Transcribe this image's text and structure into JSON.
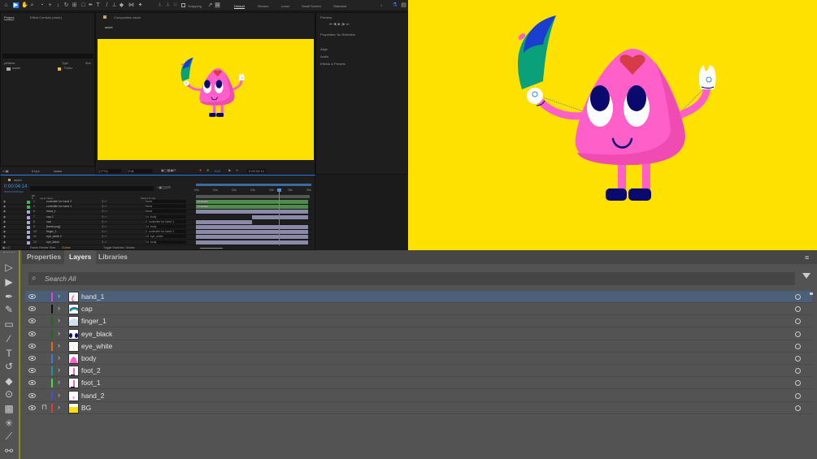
{
  "ae": {
    "toolbar": {
      "snapping": "Snapping",
      "workspaces": [
        "Default",
        "Review",
        "Learn",
        "Small Screen",
        "Standard"
      ],
      "more": "»"
    },
    "project": {
      "tabs": [
        "Project",
        "Effect Controls (none)"
      ],
      "search_placeholder": "ρ▾",
      "columns": [
        "Name",
        "Type",
        "Size"
      ],
      "items": [
        {
          "name": "assets",
          "type": "Folder"
        }
      ],
      "bpc": "8 bpc"
    },
    "comp": {
      "tab": "Composition asset",
      "breadcrumb": "asset",
      "zoom": "(77%)",
      "resolution": "Full",
      "exposure": "+0.0",
      "timecode": "0:00:04:14"
    },
    "right": {
      "preview": "Preview",
      "properties": "Properties: No Selection",
      "sections": [
        "Align",
        "Audio",
        "Effects & Presets"
      ]
    },
    "timeline": {
      "tab": "asset",
      "timecode": "0:00:04:14",
      "frames": "00134 (30.00 fps)",
      "search_placeholder": "ρ▾",
      "headers": {
        "num": "#",
        "name": "Layer Name",
        "parent": "Parent & Link"
      },
      "ruler": [
        "00s",
        "01s",
        "02s",
        "03s",
        "04s",
        "05s",
        "06s"
      ],
      "layers": [
        {
          "num": "1",
          "name": "controller for hand 2",
          "parent": "None",
          "color": "#3fb54a",
          "bar": "controller"
        },
        {
          "num": "2",
          "name": "controller for hand 1",
          "parent": "None",
          "color": "#3fb54a",
          "bar": "controller"
        },
        {
          "num": "6",
          "name": "hand_1",
          "parent": "None",
          "color": "#a9a9d6",
          "bar": "full"
        },
        {
          "num": "7",
          "name": "cap 2",
          "parent": "14. body",
          "color": "#a9a9d6",
          "bar": "late"
        },
        {
          "num": "8",
          "name": "cap",
          "parent": "2. controller for hand 1",
          "color": "#a9a9d6",
          "bar": "early"
        },
        {
          "num": "9",
          "name": "[heart.png]",
          "parent": "14. body",
          "color": "#a9a9d6",
          "bar": "full"
        },
        {
          "num": "10",
          "name": "finger_1",
          "parent": "2. controller for hand 1",
          "color": "#a9a9d6",
          "bar": "full"
        },
        {
          "num": "11",
          "name": "eye_white 2",
          "parent": "13. eye_white",
          "color": "#a9a9d6",
          "bar": "full"
        },
        {
          "num": "12",
          "name": "eye_black",
          "parent": "14. body",
          "color": "#a9a9d6",
          "bar": "full"
        }
      ],
      "bar_label": "Controller",
      "footer": {
        "render_label": "Frame Render Time",
        "render_value": "214ms",
        "toggle": "Toggle Switches / Modes"
      }
    }
  },
  "layers_panel": {
    "tabs": [
      "Properties",
      "Layers",
      "Libraries"
    ],
    "active_tab": "Layers",
    "search_placeholder": "Search All",
    "layers": [
      {
        "name": "hand_1",
        "color": "#e040e0",
        "selected": true,
        "locked": false
      },
      {
        "name": "cap",
        "color": "#111111",
        "selected": false,
        "locked": false
      },
      {
        "name": "finger_1",
        "color": "#1e6b1e",
        "selected": false,
        "locked": false
      },
      {
        "name": "eye_black",
        "color": "#1e6b1e",
        "selected": false,
        "locked": false
      },
      {
        "name": "eye_white",
        "color": "#e86a10",
        "selected": false,
        "locked": false
      },
      {
        "name": "body",
        "color": "#3b7be0",
        "selected": false,
        "locked": false
      },
      {
        "name": "foot_2",
        "color": "#1a9a9a",
        "selected": false,
        "locked": false
      },
      {
        "name": "foot_1",
        "color": "#40e040",
        "selected": false,
        "locked": false
      },
      {
        "name": "hand_2",
        "color": "#4a4ae0",
        "selected": false,
        "locked": false
      },
      {
        "name": "BG",
        "color": "#e03a3a",
        "selected": false,
        "locked": true
      }
    ]
  },
  "colors": {
    "bg_yellow": "#ffe100",
    "body_pink": "#ff5fc8",
    "navy": "#0a0a6e",
    "selection": "#4b5f78"
  }
}
